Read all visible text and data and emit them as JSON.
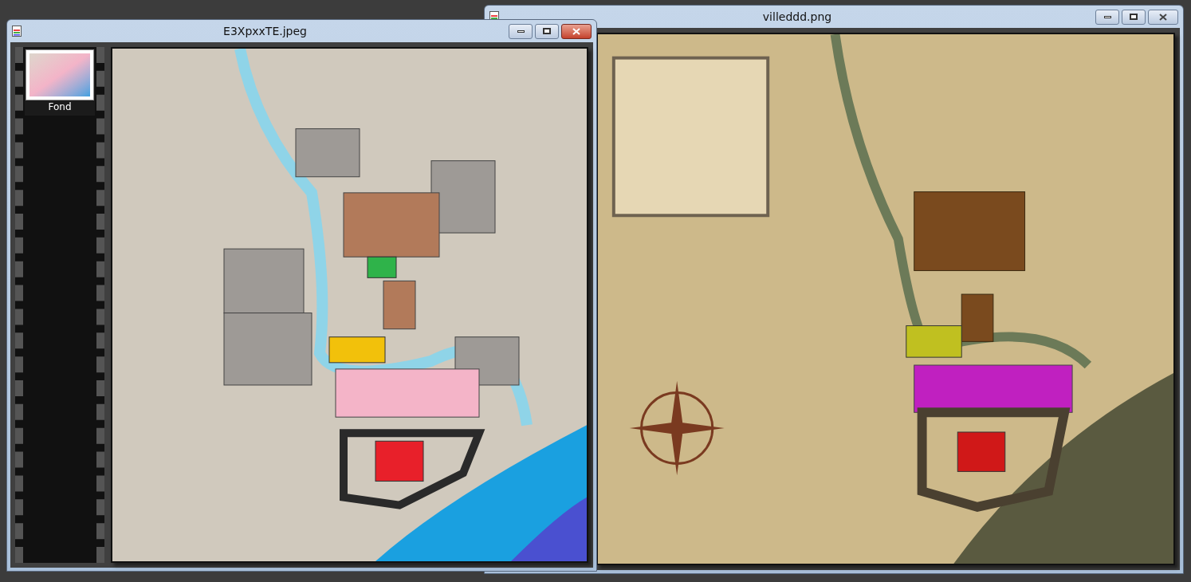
{
  "windows": [
    {
      "title": "villeddd.png",
      "active": false,
      "kind": "parchment-map"
    },
    {
      "title": "E3XpxxTE.jpeg",
      "active": true,
      "kind": "plain-map",
      "filmstrip": [
        {
          "label": "Fond",
          "selected": true
        }
      ]
    }
  ]
}
